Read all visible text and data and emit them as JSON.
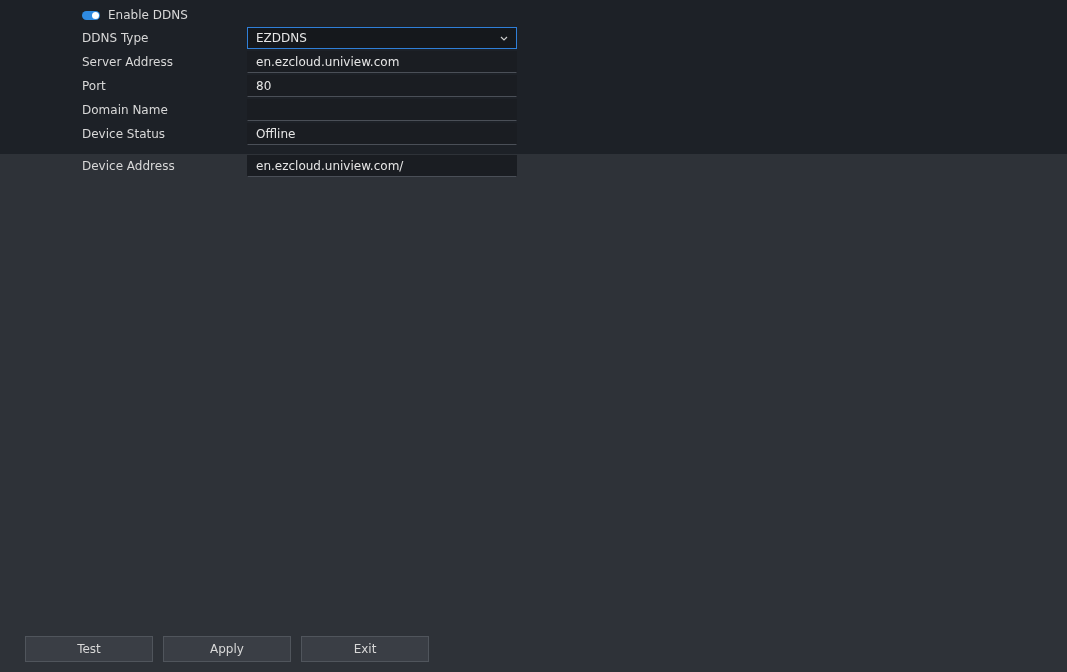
{
  "enable_ddns": {
    "label": "Enable DDNS",
    "on": true
  },
  "fields": [
    {
      "label": "DDNS Type",
      "kind": "select",
      "value": "EZDDNS",
      "focused": true
    },
    {
      "label": "Server Address",
      "kind": "text",
      "value": "en.ezcloud.uniview.com",
      "focused": false
    },
    {
      "label": "Port",
      "kind": "text",
      "value": "80",
      "focused": false
    },
    {
      "label": "Domain Name",
      "kind": "text",
      "focused": false
    },
    {
      "label": "Device Status",
      "kind": "text",
      "value": "Offline",
      "focused": false
    },
    {
      "label": "Device Address",
      "kind": "text",
      "value": "en.ezcloud.uniview.com/",
      "focused": false
    }
  ],
  "buttons": [
    "Test",
    "Apply",
    "Exit"
  ]
}
